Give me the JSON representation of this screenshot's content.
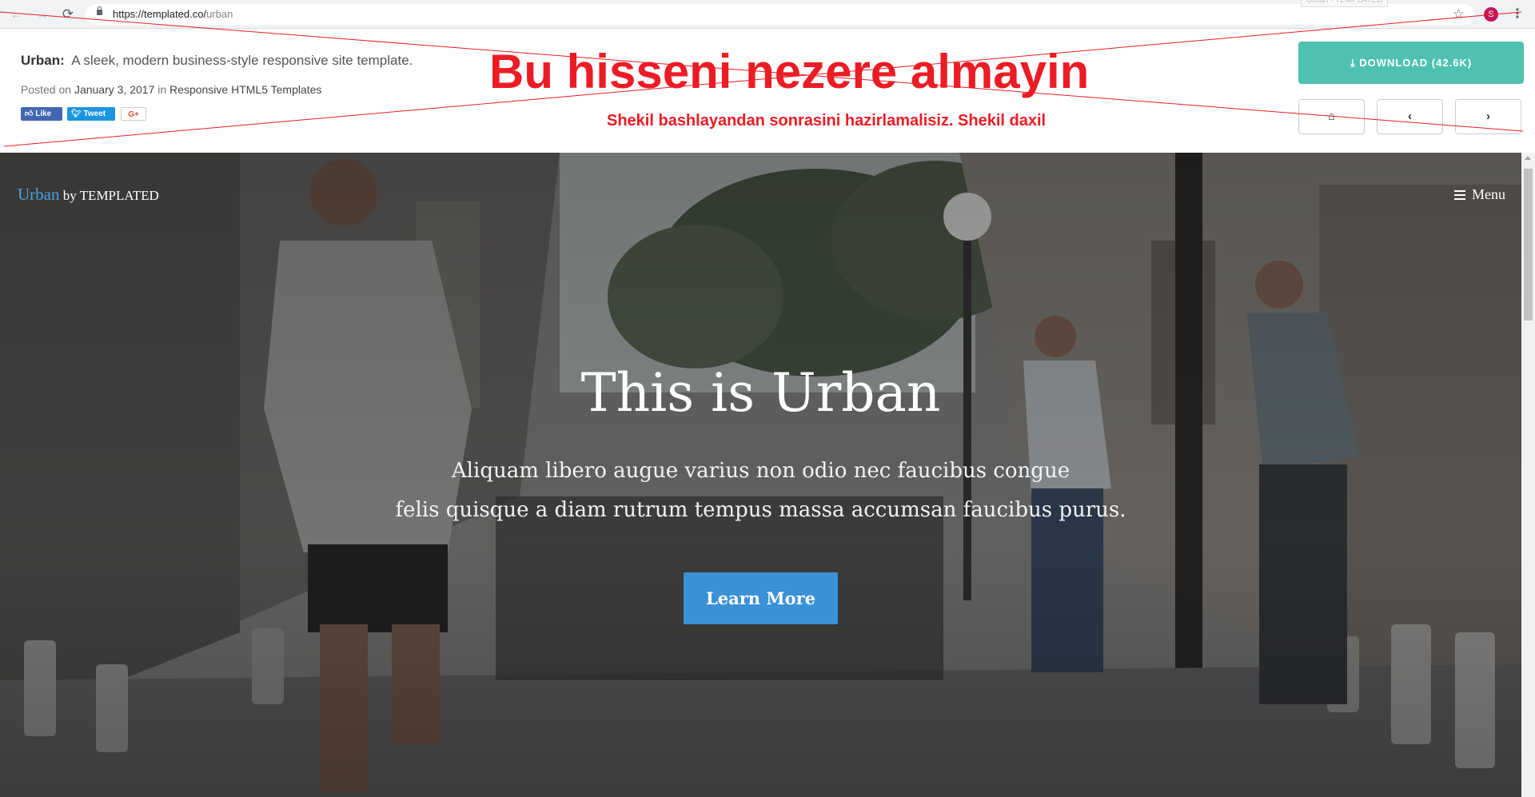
{
  "browser": {
    "url_host": "https://templated.co/",
    "url_path": "urban",
    "tab_tooltip": "Urban - TEMPLATED",
    "profile_initial": "S",
    "back_icon": "←",
    "forward_icon": "→",
    "reload_icon": "⟳",
    "star_icon": "☆",
    "menu_icon": "⋮"
  },
  "infobar": {
    "template_name": "Urban:",
    "description": "A sleek, modern business-style responsive site template.",
    "posted_prefix": "Posted on",
    "posted_date": "January 3, 2017",
    "posted_in": "in",
    "category": "Responsive HTML5 Templates",
    "fb_like": "Like",
    "tweet": "Tweet",
    "gplus": "G+",
    "download_label": "DOWNLOAD (42.6K)",
    "home_icon": "⌂",
    "prev_icon": "‹",
    "next_icon": "›"
  },
  "annotation": {
    "main": "Bu hisseni nezere almayin",
    "sub": "Shekil bashlayandan sonrasini hazirlamalisiz. Shekil daxil",
    "color": "#ec1c24"
  },
  "hero": {
    "brand_name": "Urban",
    "brand_by": "by TEMPLATED",
    "menu_label": "Menu",
    "title": "This is Urban",
    "text_line1": "Aliquam libero augue varius non odio nec faucibus congue",
    "text_line2": "felis quisque a diam rutrum tempus massa accumsan faucibus purus.",
    "button": "Learn More",
    "accent": "#3a91d6"
  }
}
